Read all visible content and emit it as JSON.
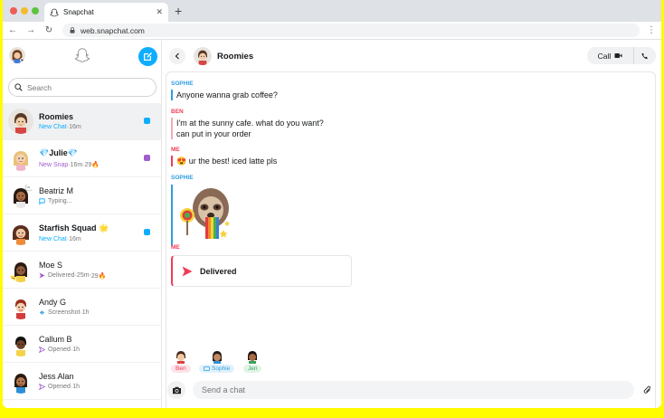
{
  "browser": {
    "tab_title": "Snapchat",
    "url": "web.snapchat.com",
    "new_tab_symbol": "+",
    "close_tab_symbol": "✕"
  },
  "colors": {
    "brand_yellow": "#FFFC00",
    "compose_blue": "#0eadff",
    "sophie_blue": "#2f9ee0",
    "red": "#f23c57",
    "snap_purple": "#a05dcd",
    "chat_blue": "#0eadff"
  },
  "sidebar": {
    "search_placeholder": "Search",
    "chats": [
      {
        "name": "Roomies",
        "status": "New Chat",
        "time": "16m",
        "status_color": "#0eadff",
        "unread": "chat",
        "selected": true
      },
      {
        "name": "💎Julie💎",
        "status": "New Snap",
        "time": "16m",
        "streak": "29🔥",
        "status_color": "#a05dcd",
        "unread": "snap"
      },
      {
        "name": "Beatriz M",
        "status": "Typing...",
        "status_color": "#0eadff"
      },
      {
        "name": "Starfish Squad 🌟",
        "status": "New Chat",
        "time": "16m",
        "status_color": "#0eadff",
        "unread": "chat"
      },
      {
        "name": "Moe S",
        "status": "Delivered",
        "time": "25m",
        "streak": "29🔥"
      },
      {
        "name": "Andy G",
        "status": "Screenshot",
        "time": "1h"
      },
      {
        "name": "Callum B",
        "status": "Opened",
        "time": "1h"
      },
      {
        "name": "Jess Alan",
        "status": "Opened",
        "time": "1h"
      }
    ]
  },
  "conversation": {
    "title": "Roomies",
    "call_label": "Call",
    "messages": [
      {
        "sender": "SOPHIE",
        "text": "Anyone wanna grab coffee?"
      },
      {
        "sender": "BEN",
        "line1": "I'm at the sunny cafe. what do you want?",
        "line2": "can put in your order"
      },
      {
        "sender": "ME",
        "text": "😍 ur the best! iced latte pls"
      },
      {
        "sender": "SOPHIE",
        "sticker": "sloth-rainbow-sticker"
      },
      {
        "sender": "ME",
        "status": "Delivered"
      }
    ],
    "presence": [
      {
        "name": "Ben",
        "color": "#f23c57",
        "bg": "#fde4e8"
      },
      {
        "name": "Sophie",
        "color": "#2f9ee0",
        "bg": "#e1f1fb"
      },
      {
        "name": "Jen",
        "color": "#37a25a",
        "bg": "#e1f4e6"
      }
    ],
    "compose_placeholder": "Send a chat"
  }
}
